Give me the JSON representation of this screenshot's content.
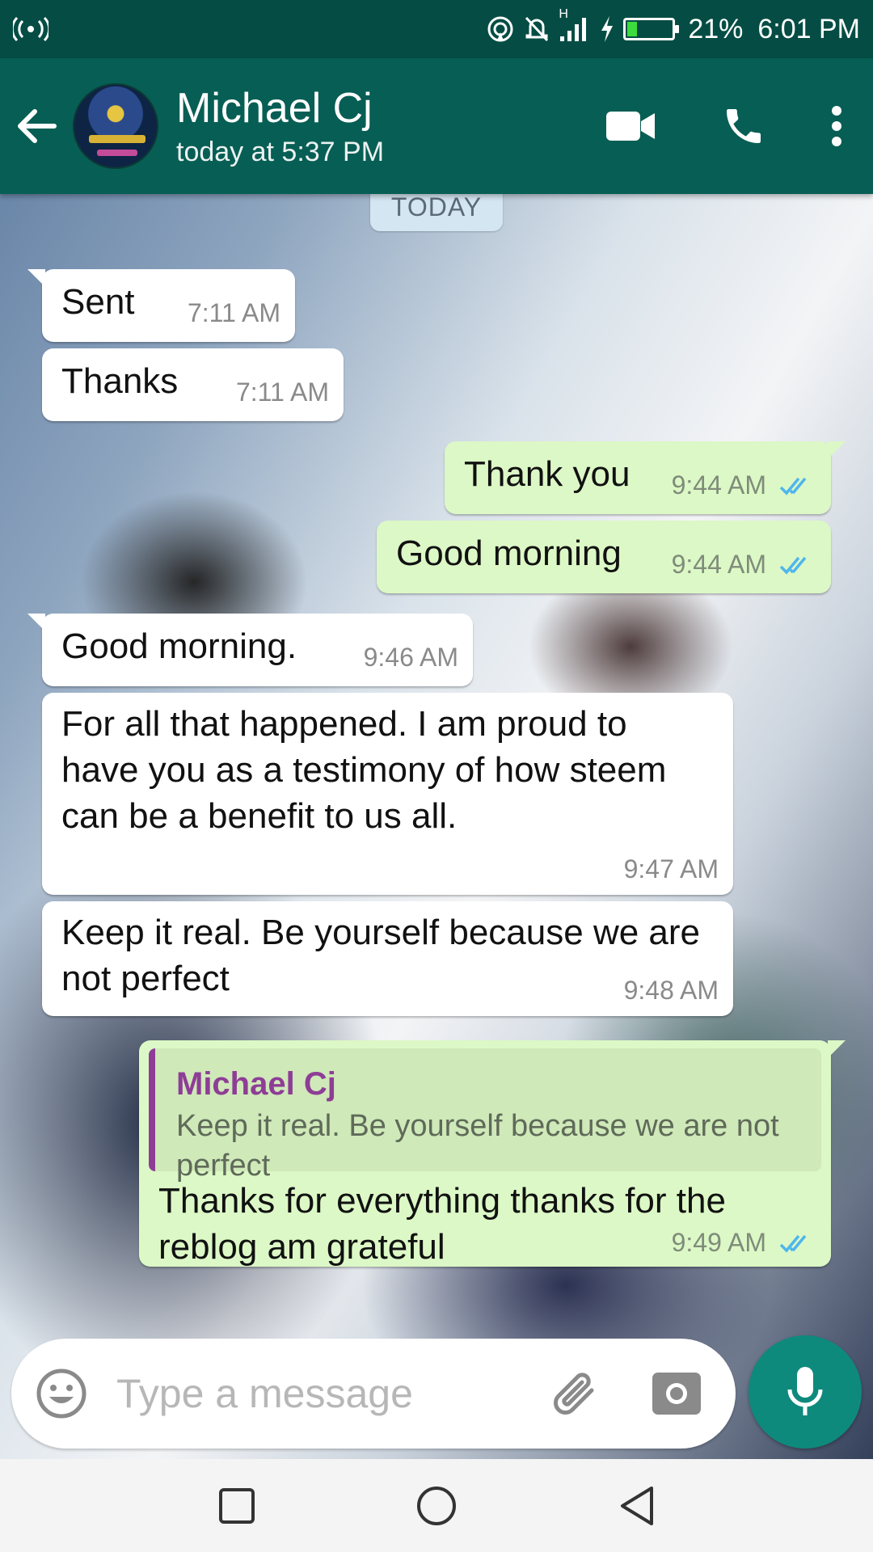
{
  "status_bar": {
    "battery_percent_label": "21%",
    "battery_level": 0.21,
    "time": "6:01 PM",
    "network_type": "H",
    "icons": [
      "radio-broadcast-icon",
      "hotspot-icon",
      "bell-off-icon",
      "signal-icon",
      "charging-bolt-icon",
      "battery-icon"
    ]
  },
  "header": {
    "contact_name": "Michael Cj",
    "last_seen": "today at 5:37 PM",
    "icons": [
      "back-arrow-icon",
      "video-call-icon",
      "phone-call-icon",
      "more-vert-icon"
    ]
  },
  "chat": {
    "date_label": "TODAY",
    "messages": [
      {
        "dir": "in",
        "text": "Sent",
        "time": "7:11 AM"
      },
      {
        "dir": "in",
        "text": "Thanks",
        "time": "7:11 AM"
      },
      {
        "dir": "out",
        "text": "Thank you",
        "time": "9:44 AM",
        "status": "read"
      },
      {
        "dir": "out",
        "text": "Good morning",
        "time": "9:44 AM",
        "status": "read"
      },
      {
        "dir": "in",
        "text": "Good morning.",
        "time": "9:46 AM"
      },
      {
        "dir": "in",
        "text": "For all that happened. I am proud to have you as a testimony of how steem can be a benefit to us all.",
        "time": "9:47 AM"
      },
      {
        "dir": "in",
        "text": "Keep it real. Be yourself because we are not perfect",
        "time": "9:48 AM"
      },
      {
        "dir": "out",
        "quote_author": "Michael Cj",
        "quote_text": "Keep it real. Be yourself because we are not perfect",
        "text": "Thanks for everything thanks for the reblog am grateful",
        "time": "9:49 AM",
        "status": "read"
      }
    ]
  },
  "input": {
    "placeholder": "Type a message",
    "value": "",
    "icons": [
      "emoji-icon",
      "attachment-icon",
      "camera-icon",
      "microphone-icon"
    ]
  },
  "colors": {
    "header": "#075e54",
    "status_bar": "#054d44",
    "outgoing_bubble": "#dcf8c6",
    "incoming_bubble": "#ffffff",
    "read_tick": "#4fb6ec",
    "quote_accent": "#8e3d96",
    "mic_button": "#0e8a7d"
  },
  "nav_bar": {
    "icons": [
      "recent-apps-square-icon",
      "home-circle-icon",
      "back-triangle-icon"
    ]
  }
}
